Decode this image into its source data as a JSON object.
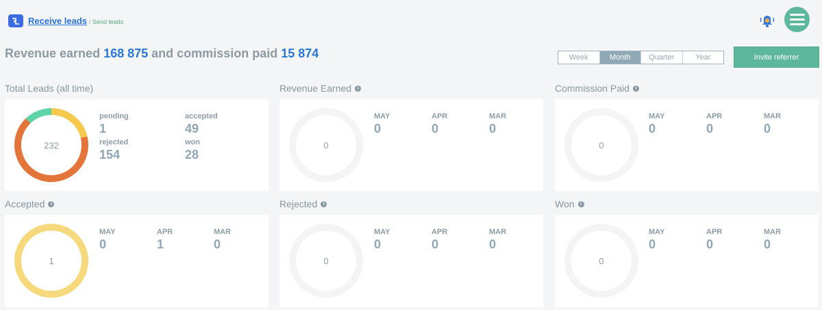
{
  "nav": {
    "receive_leads": "Receive leads",
    "separator": "/",
    "send_leads": "Send leads"
  },
  "headline": {
    "prefix": "Revenue earned",
    "revenue": "168 875",
    "middle": "and commission paid",
    "commission": "15 874"
  },
  "period": {
    "options": [
      "Week",
      "Month",
      "Quarter",
      "Year"
    ],
    "selected": "Month"
  },
  "invite_label": "Invite referrer",
  "colors": {
    "accent": "#5db89b",
    "link": "#2b73d9",
    "pending": "#5fd3a8",
    "accepted": "#f5c94e",
    "rejected": "#e4753a",
    "accepted_ring": "#f7d97d",
    "empty_ring": "#f4f4f4"
  },
  "panels": {
    "total_leads": {
      "title": "Total Leads (all time)",
      "center": "232",
      "stats": {
        "pending": {
          "label": "pending",
          "value": "1"
        },
        "accepted": {
          "label": "accepted",
          "value": "49"
        },
        "rejected": {
          "label": "rejected",
          "value": "154"
        },
        "won": {
          "label": "won",
          "value": "28"
        }
      }
    },
    "revenue_earned": {
      "title": "Revenue Earned",
      "center": "0",
      "months": [
        {
          "label": "MAY",
          "value": "0"
        },
        {
          "label": "APR",
          "value": "0"
        },
        {
          "label": "MAR",
          "value": "0"
        }
      ]
    },
    "commission_paid": {
      "title": "Commission Paid",
      "center": "0",
      "months": [
        {
          "label": "MAY",
          "value": "0"
        },
        {
          "label": "APR",
          "value": "0"
        },
        {
          "label": "MAR",
          "value": "0"
        }
      ]
    },
    "accepted": {
      "title": "Accepted",
      "center": "1",
      "months": [
        {
          "label": "MAY",
          "value": "0"
        },
        {
          "label": "APR",
          "value": "1"
        },
        {
          "label": "MAR",
          "value": "0"
        }
      ]
    },
    "rejected": {
      "title": "Rejected",
      "center": "0",
      "months": [
        {
          "label": "MAY",
          "value": "0"
        },
        {
          "label": "APR",
          "value": "0"
        },
        {
          "label": "MAR",
          "value": "0"
        }
      ]
    },
    "won": {
      "title": "Won",
      "center": "0",
      "months": [
        {
          "label": "MAY",
          "value": "0"
        },
        {
          "label": "APR",
          "value": "0"
        },
        {
          "label": "MAR",
          "value": "0"
        }
      ]
    }
  }
}
